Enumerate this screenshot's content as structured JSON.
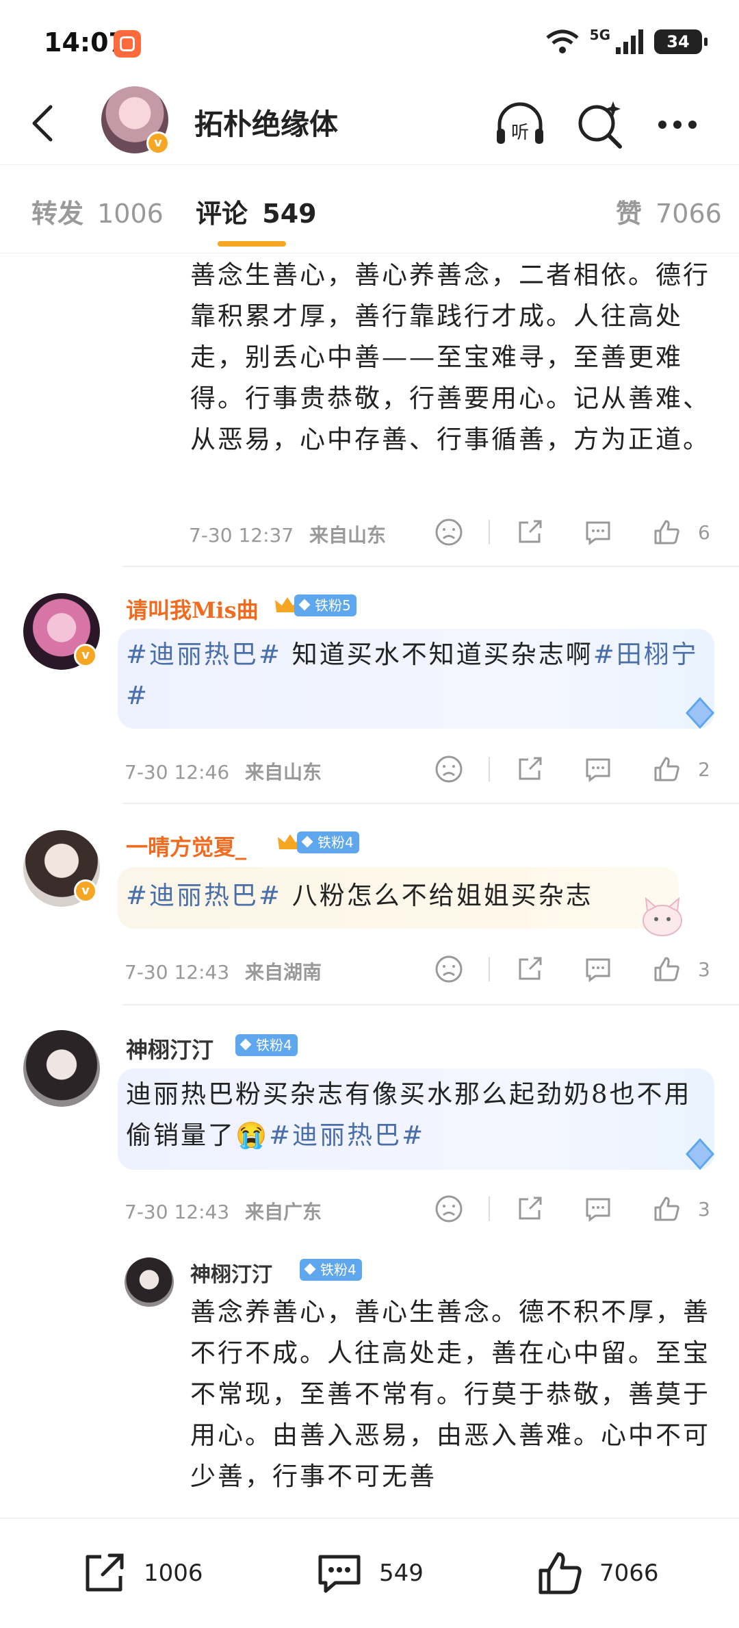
{
  "status_bar": {
    "time": "14:07",
    "network": "5G",
    "battery": "34"
  },
  "header": {
    "title": "拓朴绝缘体",
    "back_icon": "chevron-left-icon",
    "listen_icon": "headphones-listen-icon",
    "listen_glyph": "听",
    "search_icon": "search-sparkle-icon",
    "more_icon": "more-dots-icon"
  },
  "tabs": [
    {
      "label": "转发",
      "count": "1006"
    },
    {
      "label": "评论",
      "count": "549"
    },
    {
      "label": "赞",
      "count": "7066"
    }
  ],
  "comments": [
    {
      "text": "善念生善心，善心养善念，二者相依。德行靠积累才厚，善行靠践行才成。人往高处走，别丢心中善——至宝难寻，至善更难得。行事贵恭敬，行善要用心。记从善难、从恶易，心中存善、行事循善，方为正道。",
      "time": "7-30 12:37",
      "location": "来自山东",
      "likes": "6"
    },
    {
      "username": "请叫我Mis曲",
      "badge": "铁粉5",
      "hashtag1": "#迪丽热巴#",
      "text": " 知道买水不知道买杂志啊",
      "hashtag2": "#田栩宁#",
      "time": "7-30 12:46",
      "location": "来自山东",
      "likes": "2"
    },
    {
      "username": "一晴方觉夏_",
      "badge": "铁粉4",
      "hashtag1": "#迪丽热巴#",
      "text": " 八粉怎么不给姐姐买杂志",
      "time": "7-30 12:43",
      "location": "来自湖南",
      "likes": "3"
    },
    {
      "username": "神栩汀汀",
      "badge": "铁粉4",
      "text": "迪丽热巴粉买杂志有像买水那么起劲奶8也不用偷销量了😭",
      "hashtag1": "#迪丽热巴#",
      "time": "7-30 12:43",
      "location": "来自广东",
      "likes": "3"
    },
    {
      "username": "神栩汀汀",
      "badge": "铁粉4",
      "text": "善念养善心，善心生善念。德不积不厚，善不行不成。人往高处走，善在心中留。至宝不常现，至善不常有。行莫于恭敬，善莫于用心。由善入恶易，由恶入善难。心中不可少善，行事不可无善"
    }
  ],
  "bottom_bar": {
    "repost": "1006",
    "comment": "549",
    "like": "7066"
  },
  "colors": {
    "accent": "#f5a623",
    "hashtag": "#4a6ea8",
    "username_vip": "#f06b1f",
    "fan_badge": "#5ea7ee"
  }
}
